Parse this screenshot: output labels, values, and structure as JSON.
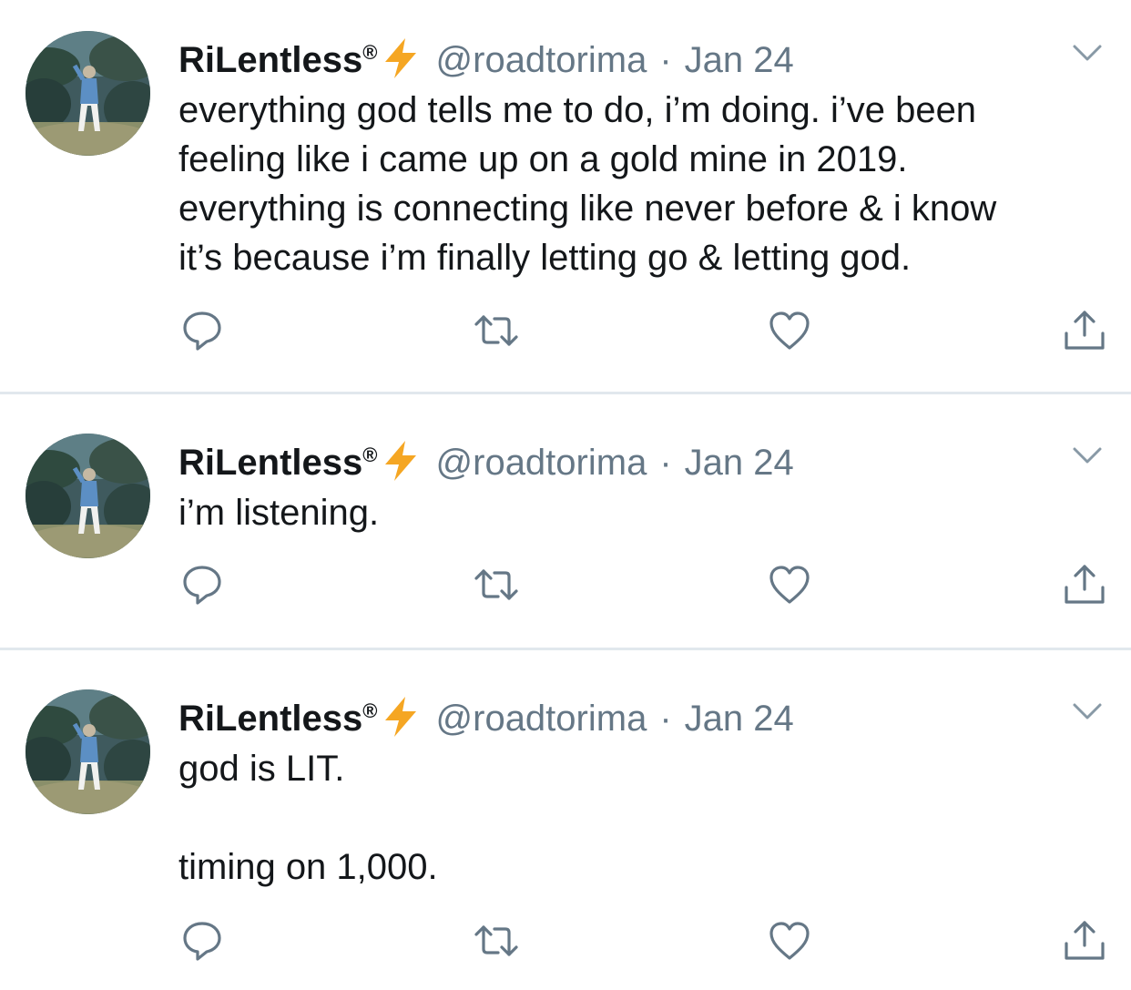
{
  "colors": {
    "text": "#14171a",
    "muted": "#657786",
    "divider": "#e1e8ed",
    "bolt": "#f5a623"
  },
  "icons": {
    "reply": "speech-bubble-icon",
    "retweet": "retweet-arrows-icon",
    "like": "heart-icon",
    "share": "share-upload-icon",
    "menu": "chevron-down-icon",
    "badge": "lightning-bolt-icon"
  },
  "tweets": [
    {
      "name": "RiLentless",
      "reg": "®",
      "handle": "@roadtorima",
      "sep": "·",
      "date": "Jan 24",
      "lines": [
        "everything god tells me to do, i’m doing. i’ve been",
        "feeling like i came up on a gold mine in 2019.",
        "everything is connecting like never before & i know",
        "it’s because i’m finally letting go & letting god."
      ]
    },
    {
      "name": "RiLentless",
      "reg": "®",
      "handle": "@roadtorima",
      "sep": "·",
      "date": "Jan 24",
      "lines": [
        "i’m listening."
      ]
    },
    {
      "name": "RiLentless",
      "reg": "®",
      "handle": "@roadtorima",
      "sep": "·",
      "date": "Jan 24",
      "lines": [
        "god is LIT.",
        "timing on 1,000."
      ]
    }
  ]
}
